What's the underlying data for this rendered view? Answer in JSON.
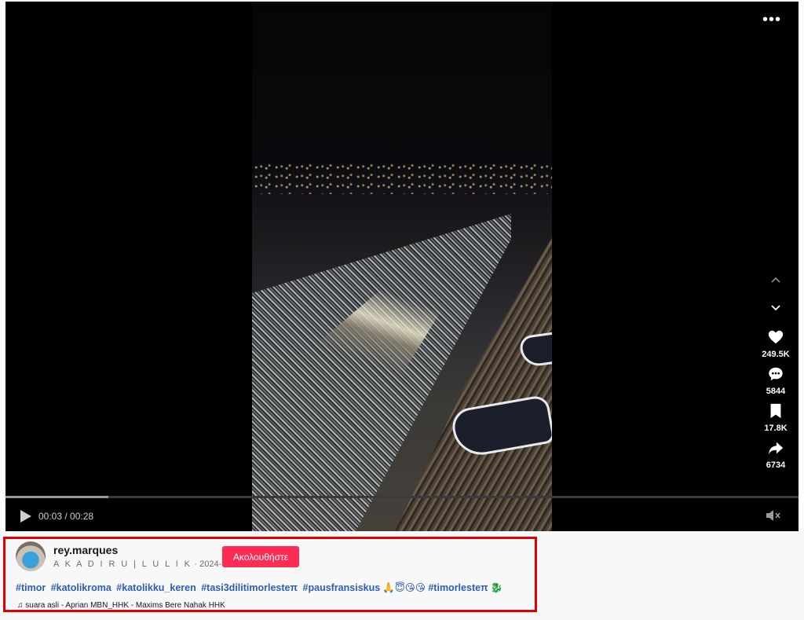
{
  "player": {
    "time_current": "00:03",
    "time_total": "00:28",
    "time_separator": " / ",
    "progress": 0.13
  },
  "actions": {
    "likes": "249.5K",
    "comments": "5844",
    "saves": "17.8K",
    "shares": "6734"
  },
  "author": {
    "username": "rey.marques",
    "nickname": "A K A D I R U | L U L I K",
    "date": "2024-9-11",
    "follow_label": "Ακολουθήστε"
  },
  "caption": {
    "hashtags": [
      "#timor",
      "#katolikroma",
      "#katolikku_keren",
      "#tasi3dilitimorlesteπ",
      "#pausfransiskus",
      "#timorlesteπ"
    ],
    "emojis_1": "🙏😇😘😘",
    "emojis_2": "🐉"
  },
  "music": {
    "icon": "music-note-icon",
    "title": "suara asli - Aprian MBN_HHK - Maxims Bere Nahak HHK"
  },
  "colors": {
    "accent": "#fe2c55",
    "hashtag": "#2b5db8",
    "highlight": "#e10000"
  }
}
